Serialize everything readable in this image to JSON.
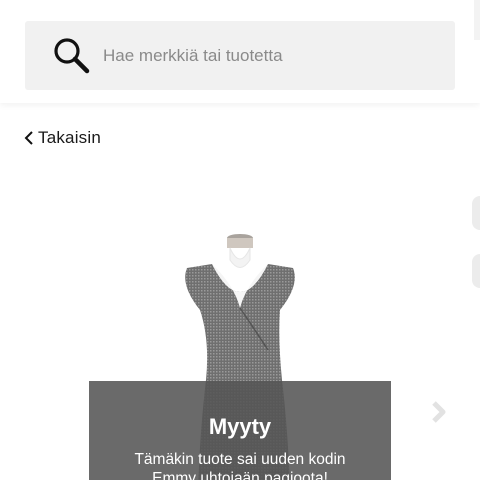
{
  "search": {
    "placeholder": "Hae merkkiä tai tuotetta",
    "value": "",
    "icon": "search-icon"
  },
  "navigation": {
    "back_label": "Takaisin",
    "back_icon": "chevron-left-icon",
    "next_icon": "chevron-right-icon"
  },
  "product": {
    "image_icon": "dress-on-mannequin"
  },
  "sold_overlay": {
    "title": "Myyty",
    "line1": "Tämäkin tuote sai uuden kodin",
    "line2": "Emmy uhtoiaän pagioota!"
  },
  "colors": {
    "search_bg": "#f1f1f1",
    "overlay_bg": "#555555",
    "text_dark": "#1a1a1a",
    "placeholder": "#8a8a8a"
  }
}
